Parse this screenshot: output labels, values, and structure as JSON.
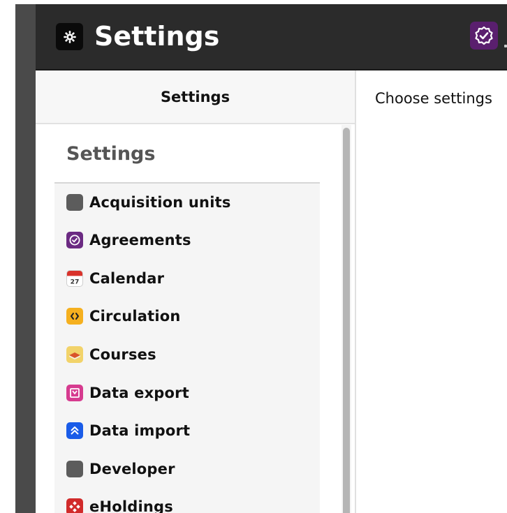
{
  "app": {
    "title": "Settings",
    "icon": "gear-icon",
    "right_icon": "agreements-icon"
  },
  "nav": {
    "header": "Settings",
    "section_heading": "Settings",
    "items": [
      {
        "label": "Acquisition units",
        "icon": "acquisition-units-icon",
        "color": "#5c5c5c"
      },
      {
        "label": "Agreements",
        "icon": "agreements-icon",
        "color": "#6b2a82"
      },
      {
        "label": "Calendar",
        "icon": "calendar-icon",
        "color": "#d9322b",
        "glyph": "27"
      },
      {
        "label": "Circulation",
        "icon": "circulation-icon",
        "color": "#f5b01f"
      },
      {
        "label": "Courses",
        "icon": "courses-icon",
        "color": "#f2d36a"
      },
      {
        "label": "Data export",
        "icon": "data-export-icon",
        "color": "#d63b8f"
      },
      {
        "label": "Data import",
        "icon": "data-import-icon",
        "color": "#1a5ce8"
      },
      {
        "label": "Developer",
        "icon": "developer-icon",
        "color": "#5c5c5c"
      },
      {
        "label": "eHoldings",
        "icon": "eholdings-icon",
        "color": "#d12b2b"
      }
    ]
  },
  "content": {
    "message": "Choose settings"
  },
  "colors": {
    "appbar": "#2b2b2b",
    "strip": "#4a4a4a",
    "nav_header_bg": "#f7f7f7",
    "nav_list_bg": "#f5f5f5"
  }
}
